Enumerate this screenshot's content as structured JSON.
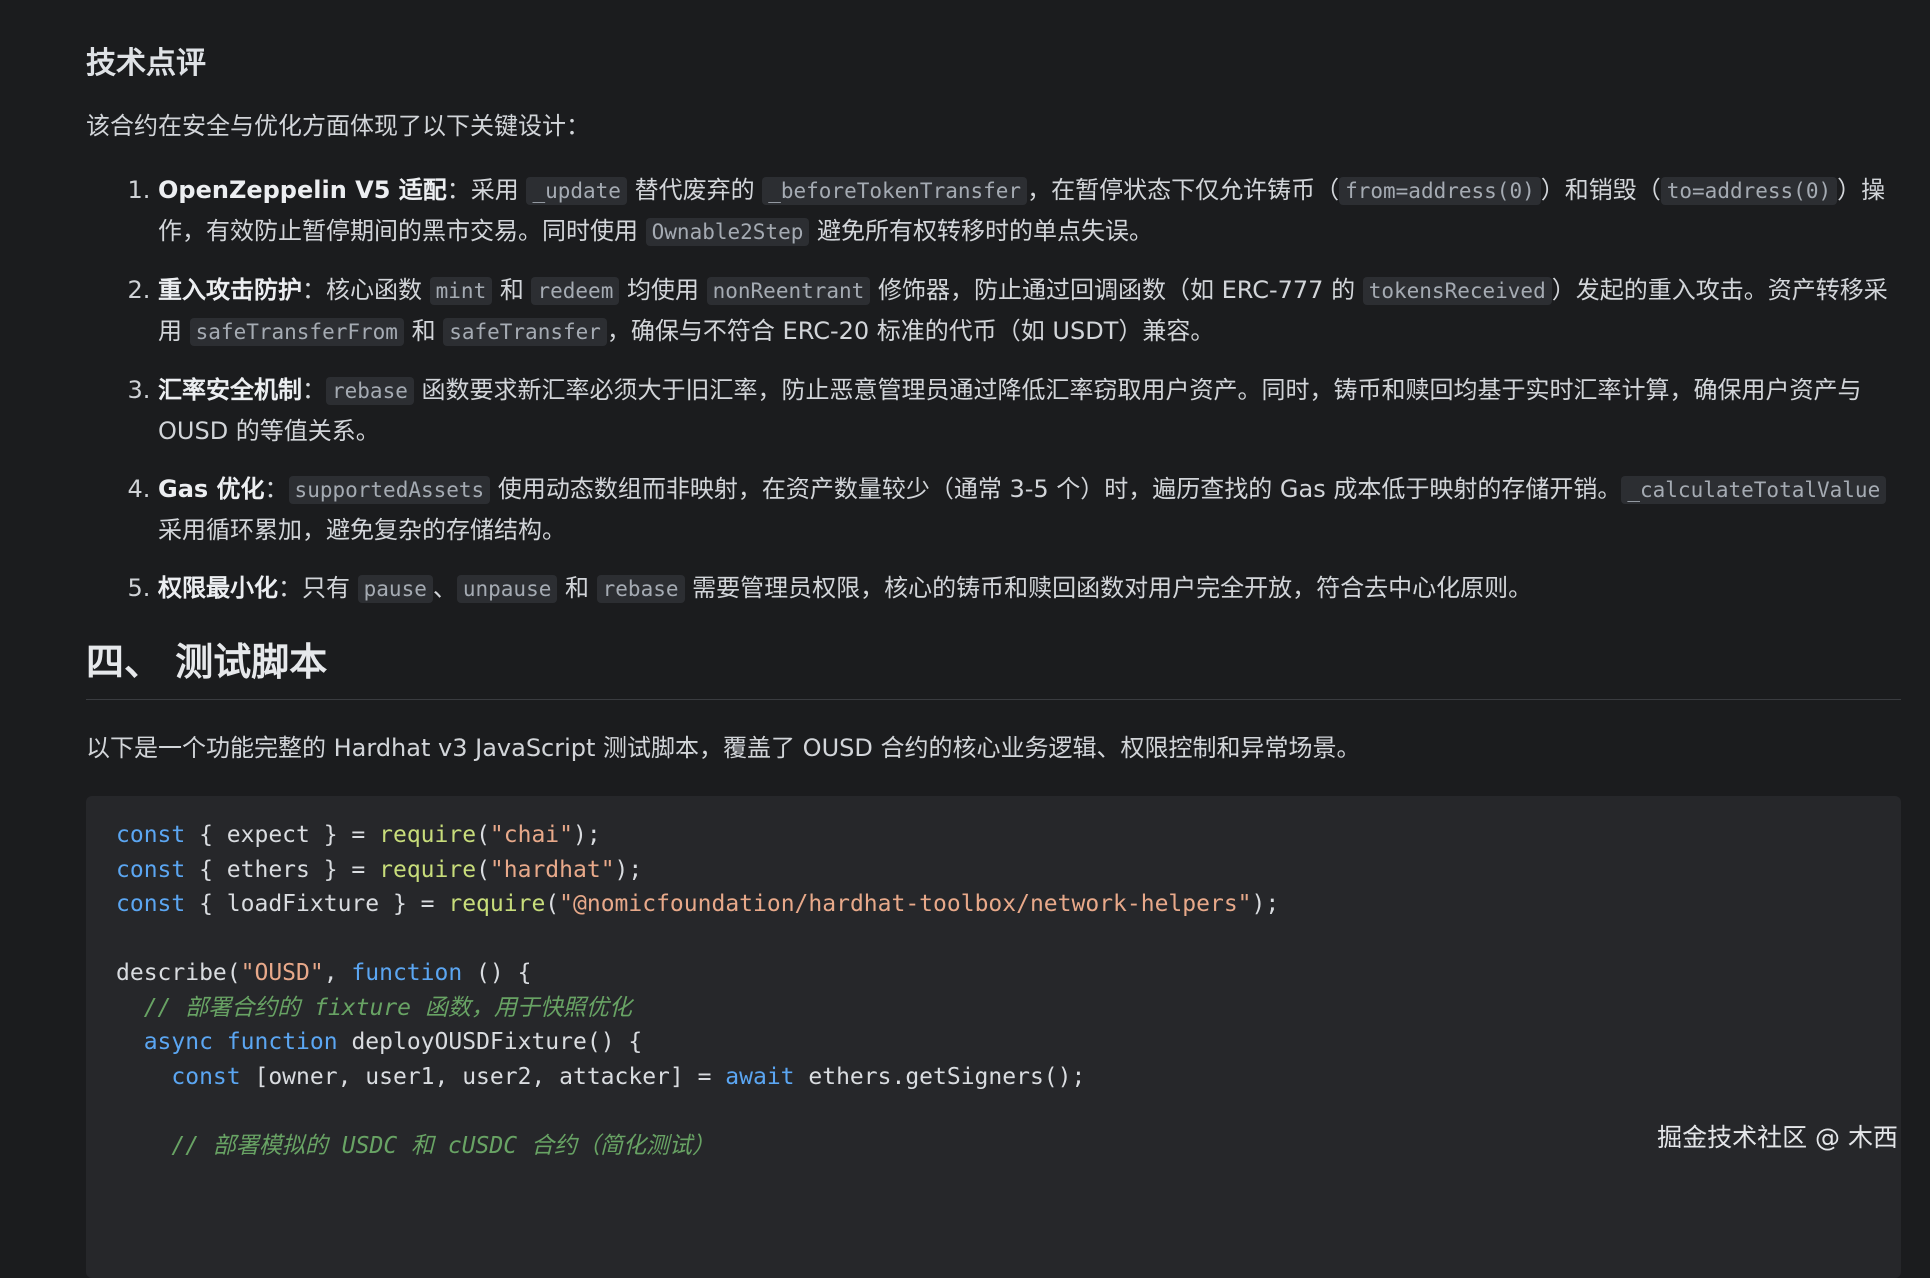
{
  "review": {
    "title": "技术点评",
    "intro": "该合约在安全与优化方面体现了以下关键设计：",
    "points": [
      {
        "label": "OpenZeppelin V5 适配",
        "t1": "：采用 ",
        "c1": "_update",
        "t2": " 替代废弃的 ",
        "c2": "_beforeTokenTransfer",
        "t3": "，在暂停状态下仅允许铸币（",
        "c3": "from=address(0)",
        "t4": "）和销毁（",
        "c4": "to=address(0)",
        "t5": "）操作，有效防止暂停期间的黑市交易。同时使用 ",
        "c5": "Ownable2Step",
        "t6": " 避免所有权转移时的单点失误。"
      },
      {
        "label": "重入攻击防护",
        "t1": "：核心函数 ",
        "c1": "mint",
        "t2": " 和 ",
        "c2": "redeem",
        "t3": " 均使用 ",
        "c3": "nonReentrant",
        "t4": " 修饰器，防止通过回调函数（如 ERC-777 的 ",
        "c4": "tokensReceived",
        "t5": "）发起的重入攻击。资产转移采用 ",
        "c5": "safeTransferFrom",
        "t6": " 和 ",
        "c6": "safeTransfer",
        "t7": "，确保与不符合 ERC-20 标准的代币（如 USDT）兼容。"
      },
      {
        "label": "汇率安全机制",
        "t1": "：",
        "c1": "rebase",
        "t2": " 函数要求新汇率必须大于旧汇率，防止恶意管理员通过降低汇率窃取用户资产。同时，铸币和赎回均基于实时汇率计算，确保用户资产与 OUSD 的等值关系。"
      },
      {
        "label": "Gas 优化",
        "t1": "：",
        "c1": "supportedAssets",
        "t2": " 使用动态数组而非映射，在资产数量较少（通常 3-5 个）时，遍历查找的 Gas 成本低于映射的存储开销。",
        "c2": "_calculateTotalValue",
        "t3": " 采用循环累加，避免复杂的存储结构。"
      },
      {
        "label": "权限最小化",
        "t1": "：只有 ",
        "c1": "pause",
        "t2": "、",
        "c2": "unpause",
        "t3": " 和 ",
        "c3": "rebase",
        "t4": " 需要管理员权限，核心的铸币和赎回函数对用户完全开放，符合去中心化原则。"
      }
    ]
  },
  "section": {
    "title": "四、 测试脚本",
    "desc": "以下是一个功能完整的 Hardhat v3 JavaScript 测试脚本，覆盖了 OUSD 合约的核心业务逻辑、权限控制和异常场景。"
  },
  "code": {
    "const": "const",
    "require": "require",
    "function": "function",
    "async": "async",
    "await": "await",
    "l1_mid": " { expect } = ",
    "l1_str": "\"chai\"",
    "l2_mid": " { ethers } = ",
    "l2_str": "\"hardhat\"",
    "l3_mid": " { loadFixture } = ",
    "l3_str": "\"@nomicfoundation/hardhat-toolbox/network-helpers\"",
    "open_paren": "(",
    "close_paren_semi": ");",
    "describe": "describe(",
    "describe_str": "\"OUSD\"",
    "comma": ", ",
    "paren_brace": " () {",
    "comment1": "// 部署合约的 fixture 函数，用于快照优化",
    "deploy_fn": " deployOUSDFixture() {",
    "signers_mid": " [owner, user1, user2, attacker] = ",
    "signers_call": " ethers.getSigners();",
    "comment2": "// 部署模拟的 USDC 和 cUSDC 合约（简化测试）"
  },
  "watermark": "掘金技术社区 @ 木西"
}
